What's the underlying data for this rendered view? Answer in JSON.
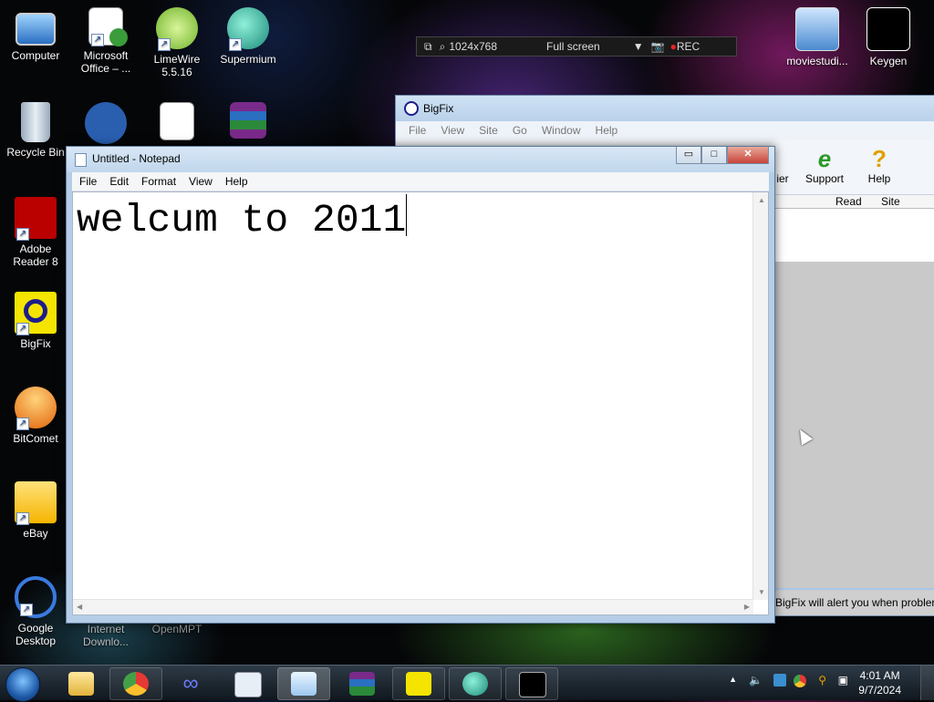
{
  "desktop": {
    "icons": [
      {
        "label": "Computer",
        "icon": "computer-icon"
      },
      {
        "label": "Microsoft Office – ...",
        "icon": "office-setup-icon"
      },
      {
        "label": "LimeWire 5.5.16",
        "icon": "limewire-icon"
      },
      {
        "label": "Supermium",
        "icon": "supermium-icon"
      },
      {
        "label": "Recycle Bin",
        "icon": "recycle-bin-icon"
      },
      {
        "label": "Adobe Reader 8",
        "icon": "adobe-reader-icon"
      },
      {
        "label": "BigFix",
        "icon": "bigfix-icon"
      },
      {
        "label": "BitComet",
        "icon": "bitcomet-icon"
      },
      {
        "label": "eBay",
        "icon": "ebay-icon"
      },
      {
        "label": "Google Desktop",
        "icon": "google-desktop-icon"
      },
      {
        "label": "Internet Downlo...",
        "icon": "idm-icon"
      },
      {
        "label": "OpenMPT",
        "icon": "openmpt-icon"
      },
      {
        "label": "moviestudi...",
        "icon": "moviestudio-icon"
      },
      {
        "label": "Keygen",
        "icon": "keygen-icon"
      }
    ]
  },
  "capture_toolbar": {
    "resolution": "1024x768",
    "mode": "Full screen",
    "rec": "REC"
  },
  "bigfix": {
    "title": "BigFix",
    "menu": [
      "File",
      "View",
      "Site",
      "Go",
      "Window",
      "Help"
    ],
    "toolbar": {
      "partial_label": "ier",
      "support": "Support",
      "help": "Help"
    },
    "columns": [
      "Read",
      "Site"
    ],
    "status": "BigFix will alert you when probler"
  },
  "notepad": {
    "title": "Untitled - Notepad",
    "menu": [
      "File",
      "Edit",
      "Format",
      "View",
      "Help"
    ],
    "content": "welcum to 2011",
    "buttons": {
      "minimize": "▭",
      "maximize": "□",
      "close": "✕"
    }
  },
  "taskbar": {
    "time": "4:01 AM",
    "date": "9/7/2024"
  },
  "colors": {
    "taskbar": "#10171e",
    "window_frame": "#b5cde6",
    "close_button": "#c7453a"
  }
}
